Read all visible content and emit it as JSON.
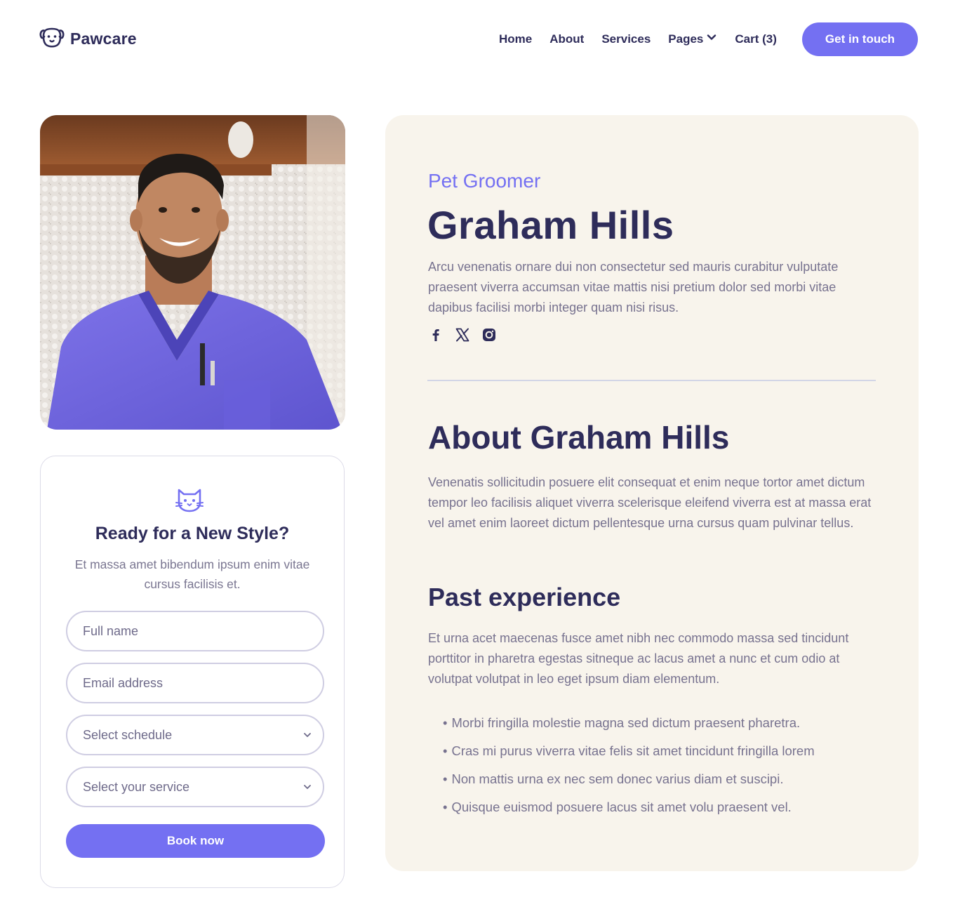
{
  "brand": {
    "name": "Pawcare",
    "logo_icon": "dog-face-icon"
  },
  "nav": {
    "items": [
      {
        "label": "Home"
      },
      {
        "label": "About"
      },
      {
        "label": "Services"
      },
      {
        "label": "Pages",
        "icon": "chevron-down-icon"
      },
      {
        "label": "Cart (3)"
      }
    ],
    "cta_label": "Get in touch"
  },
  "colors": {
    "accent": "#7470f2",
    "heading": "#2e2c5a",
    "body": "#77728f",
    "panel": "#f8f4ec"
  },
  "booking": {
    "icon": "cat-face-icon",
    "title": "Ready for a New Style?",
    "subtitle": "Et massa amet bibendum ipsum enim vitae cursus facilisis et.",
    "fields": {
      "full_name": {
        "placeholder": "Full name"
      },
      "email": {
        "placeholder": "Email address"
      },
      "schedule": {
        "value": "Select schedule"
      },
      "service": {
        "value": "Select your service"
      }
    },
    "submit_label": "Book now"
  },
  "profile": {
    "role": "Pet Groomer",
    "name": "Graham Hills",
    "bio": "Arcu venenatis ornare dui non consectetur sed mauris curabitur vulputate praesent viverra accumsan vitae mattis nisi pretium dolor sed morbi vitae dapibus facilisi morbi integer quam nisi risus.",
    "socials": [
      "facebook-icon",
      "x-icon",
      "instagram-icon"
    ],
    "about_title": "About Graham Hills",
    "about_text": "Venenatis sollicitudin posuere elit consequat et enim neque tortor amet dictum tempor leo facilisis aliquet viverra scelerisque eleifend viverra est at massa erat vel amet enim laoreet dictum pellentesque urna cursus quam pulvinar tellus.",
    "experience_title": "Past experience",
    "experience_text": "Et urna acet maecenas fusce amet nibh nec commodo massa sed tincidunt porttitor in pharetra egestas sitneque ac lacus amet a nunc et cum odio at volutpat volutpat in leo eget ipsum diam elementum.",
    "experience_points": [
      "Morbi fringilla molestie magna sed dictum praesent pharetra.",
      "Cras mi purus viverra vitae felis sit amet tincidunt fringilla lorem",
      "Non mattis urna ex nec sem donec varius diam et suscipi.",
      "Quisque euismod posuere lacus sit amet volu praesent vel."
    ]
  }
}
